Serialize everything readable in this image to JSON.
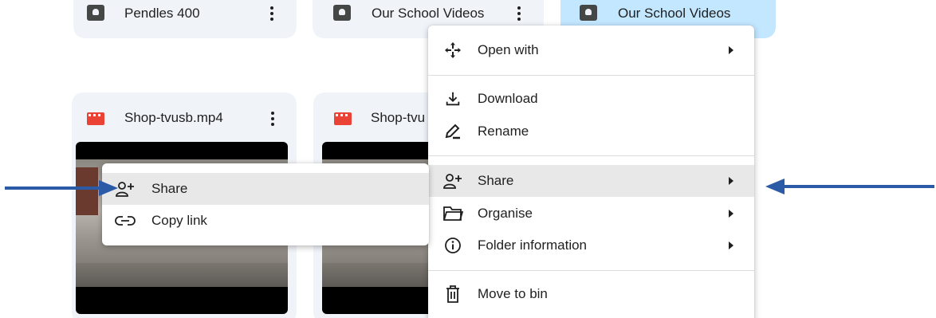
{
  "cards_top": [
    {
      "title": "Pendles 400"
    },
    {
      "title": "Our School Videos"
    },
    {
      "title": "Our School Videos"
    }
  ],
  "cards_video": [
    {
      "title": "Shop-tvusb.mp4"
    },
    {
      "title": "Shop-tvu"
    }
  ],
  "context_menu": {
    "items": [
      {
        "label": "Open with",
        "icon": "open-with-icon"
      },
      {
        "label": "Download",
        "icon": "download-icon"
      },
      {
        "label": "Rename",
        "icon": "rename-icon"
      },
      {
        "label": "Share",
        "icon": "share-icon"
      },
      {
        "label": "Organise",
        "icon": "folder-icon"
      },
      {
        "label": "Folder information",
        "icon": "info-icon"
      },
      {
        "label": "Move to bin",
        "icon": "trash-icon"
      }
    ]
  },
  "share_submenu": {
    "items": [
      {
        "label": "Share",
        "icon": "share-icon"
      },
      {
        "label": "Copy link",
        "icon": "link-icon"
      }
    ]
  },
  "colors": {
    "highlight": "#e8e8e8",
    "selected_card": "#c2e7ff",
    "annotation_arrow": "#2b5aa6"
  }
}
